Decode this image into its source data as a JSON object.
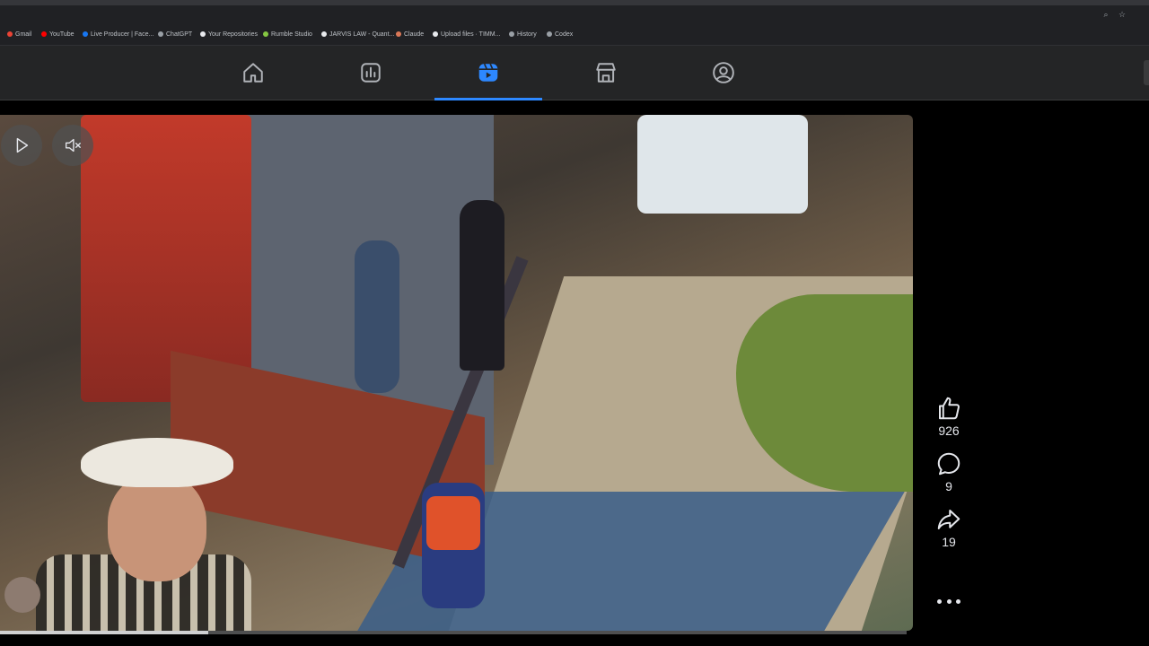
{
  "bookmarks": [
    {
      "label": "Gmail",
      "color": "#ea4335"
    },
    {
      "label": "YouTube",
      "color": "#ff0000"
    },
    {
      "label": "Live Producer | Face...",
      "color": "#1877f2"
    },
    {
      "label": "ChatGPT",
      "color": "#9aa0a6"
    },
    {
      "label": "Your Repositories",
      "color": "#e8eaed"
    },
    {
      "label": "Rumble Studio",
      "color": "#85c742"
    },
    {
      "label": "JARVIS LAW - Quant...",
      "color": "#e8eaed"
    },
    {
      "label": "Claude",
      "color": "#d97757"
    },
    {
      "label": "Upload files · TIMM...",
      "color": "#e8eaed"
    },
    {
      "label": "History",
      "color": "#9aa0a6"
    },
    {
      "label": "Codex",
      "color": "#9aa0a6"
    }
  ],
  "nav": {
    "items": [
      {
        "icon": "home-icon"
      },
      {
        "icon": "insights-icon"
      },
      {
        "icon": "reels-icon",
        "active": true
      },
      {
        "icon": "marketplace-icon"
      },
      {
        "icon": "profile-icon"
      }
    ],
    "active_color": "#2d88ff"
  },
  "video": {
    "play_icon": "play-icon",
    "mute_icon": "muted-speaker-icon",
    "progress": 0.23
  },
  "actions": {
    "likes": "926",
    "comments": "9",
    "shares": "19"
  }
}
